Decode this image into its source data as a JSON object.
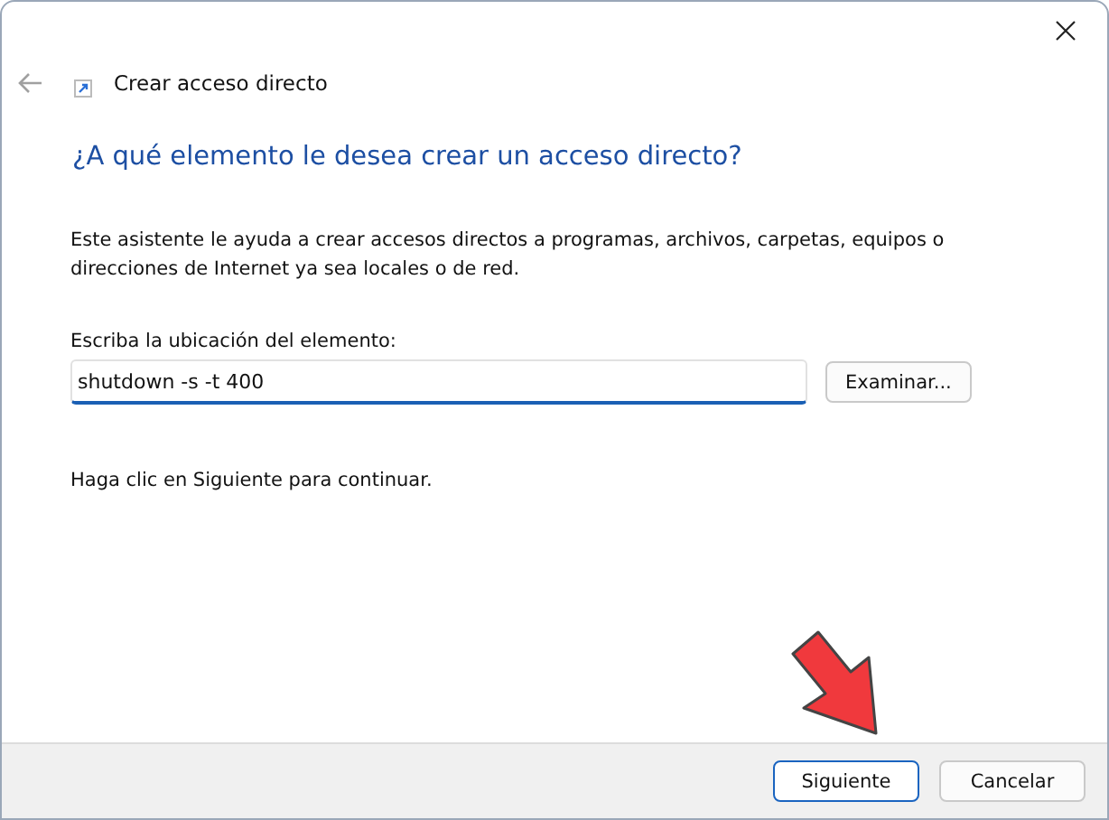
{
  "window": {
    "title": "Crear acceso directo"
  },
  "heading": "¿A qué elemento le desea crear un acceso directo?",
  "description": "Este asistente le ayuda a crear accesos directos a programas, archivos, carpetas, equipos o direcciones de Internet ya sea locales o de red.",
  "location": {
    "label": "Escriba la ubicación del elemento:",
    "value": "shutdown -s -t 400",
    "browse_button": "Examinar..."
  },
  "hint": "Haga clic en Siguiente para continuar.",
  "buttons": [
    {
      "label": "Siguiente",
      "default": true
    },
    {
      "label": "Cancelar",
      "default": false
    }
  ]
}
